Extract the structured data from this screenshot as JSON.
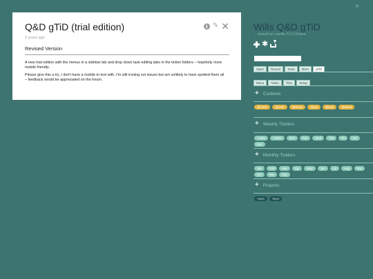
{
  "post": {
    "title": "Q&D gTiD (trial edition)",
    "age": "9 years ago",
    "subtitle": "Revised Version",
    "paragraphs": [
      "A new trial edition with the menus in a sidebar tab and drop down task editing tabs in the tickler folders – hopefully more mobile friendly.",
      "Please give this a try, I don't have a mobile to test with. I'm still ironing out issues but am unlikely to have spotted them all – feedback would be appreciated on the forum."
    ],
    "icons": [
      "info-icon",
      "pencil-icon",
      "close-icon"
    ]
  },
  "sidebar": {
    "title": "Wills Q&D gTiD",
    "subtitle": "– based on vanilla 5.0.13-beta",
    "actions": [
      "plus-icon",
      "gear-icon",
      "download-icon"
    ],
    "search": {
      "value": "",
      "placeholder": ""
    },
    "tabs_top": [
      {
        "label": "Open",
        "active": false
      },
      {
        "label": "Recent",
        "active": false
      },
      {
        "label": "Tools",
        "active": false
      },
      {
        "label": "More",
        "active": false
      },
      {
        "label": "gTiD",
        "active": true
      }
    ],
    "tabs_bottom": [
      {
        "label": "Menu",
        "active": false
      },
      {
        "label": "Tasks",
        "active": false
      },
      {
        "label": "TiDo",
        "active": false
      },
      {
        "label": "Setup",
        "active": false
      }
    ],
    "sections": {
      "contexts": {
        "label": "Contexts",
        "chips": [
          "@home",
          "@work",
          "@shops",
          "@tea",
          "@todo",
          "@wknd"
        ]
      },
      "weekly": {
        "label": "Weekly Ticklers",
        "chips": [
          ">1wks",
          ">4wks",
          "Mon",
          "Tue",
          "Wed",
          "Thu",
          "Fri",
          "Sat",
          "Sun"
        ]
      },
      "monthly": {
        "label": "Monthly Ticklers",
        "chips": [
          "Jan",
          "Feb",
          "Mar",
          "Apr",
          "May",
          "Jun",
          "Jul",
          "Aug",
          "Sep",
          "Oct",
          "Nov",
          "Dec"
        ]
      },
      "projects": {
        "label": "Projects",
        "chips": [
          ">2yrs",
          ">5yrs"
        ]
      }
    }
  },
  "toggle_icon": "double-chevron-right-icon",
  "colors": {
    "background": "#3d7470",
    "context_chip": "#e3b441",
    "tickler_chip": "#8ccab9",
    "project_chip": "#1f4f53"
  }
}
